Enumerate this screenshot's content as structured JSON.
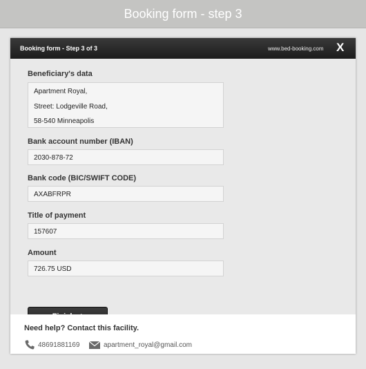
{
  "header": {
    "title": "Booking form - step 3"
  },
  "modal": {
    "title": "Booking form - Step 3 of 3",
    "site": "www.bed-booking.com",
    "close_label": "X"
  },
  "form": {
    "beneficiary": {
      "label": "Beneficiary's data",
      "lines": [
        "Apartment Royal,",
        "Street: Lodgeville Road,",
        "58-540 Minneapolis"
      ]
    },
    "account": {
      "label": "Bank account number (IBAN)",
      "value": "2030-878-72"
    },
    "bank_code": {
      "label": "Bank code (BIC/SWIFT CODE)",
      "value": "AXABFRPR"
    },
    "payment_title": {
      "label": "Title of payment",
      "value": "157607"
    },
    "amount": {
      "label": "Amount",
      "value": "726.75 USD"
    },
    "finish_label": "Finish ✓"
  },
  "help": {
    "title": "Need help? Contact this facility.",
    "phone": "48691881169",
    "email": "apartment_royal@gmail.com",
    "phone_icon": "phone-icon",
    "email_icon": "envelope-icon"
  }
}
